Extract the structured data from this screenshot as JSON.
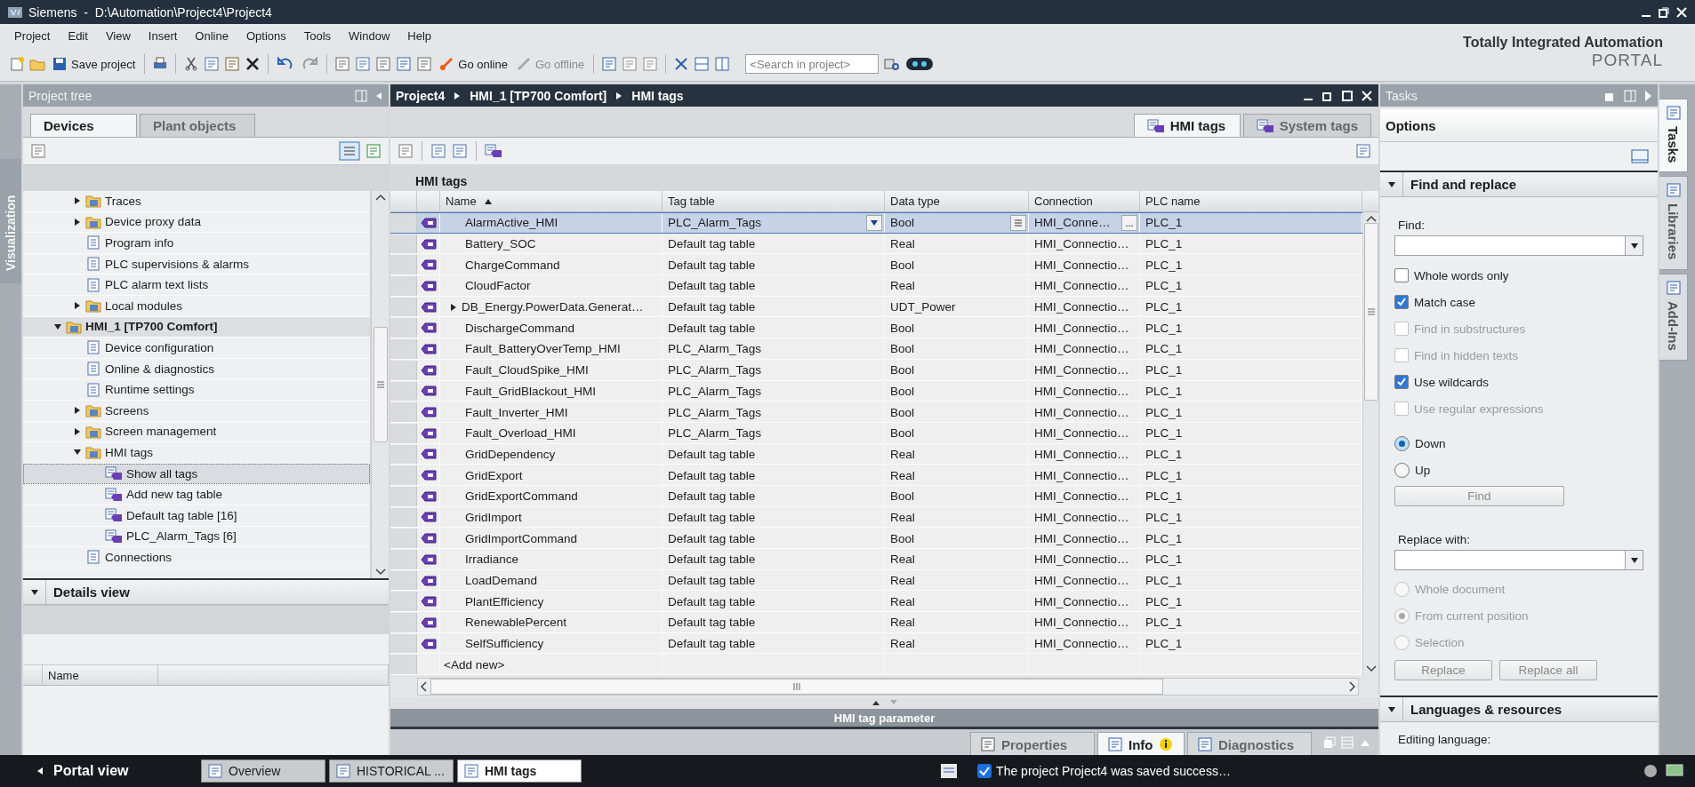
{
  "window": {
    "title": "Siemens  -  D:\\Automation\\Project4\\Project4"
  },
  "menu": [
    "Project",
    "Edit",
    "View",
    "Insert",
    "Online",
    "Options",
    "Tools",
    "Window",
    "Help"
  ],
  "toolbar": {
    "save_label": "Save project",
    "go_online": "Go online",
    "go_offline": "Go offline",
    "search_placeholder": "<Search in project>"
  },
  "brand": {
    "line1": "Totally Integrated Automation",
    "line2": "PORTAL"
  },
  "left_strip": {
    "label": "Visualization"
  },
  "project_tree": {
    "title": "Project tree",
    "tabs": [
      {
        "label": "Devices",
        "selected": true
      },
      {
        "label": "Plant objects",
        "selected": false
      }
    ],
    "continued_items": [
      {
        "label": "Traces",
        "expanded": false,
        "selected": false
      },
      {
        "label": "Device proxy data",
        "expanded": false,
        "selected": false
      },
      {
        "label": "Program info",
        "selected": false
      },
      {
        "label": "PLC supervisions & alarms",
        "selected": false
      },
      {
        "label": "PLC alarm text lists",
        "selected": false
      },
      {
        "label": "Local modules",
        "expanded": false,
        "selected": false
      }
    ],
    "items": [
      {
        "label": "HMI_1 [TP700 Comfort]",
        "expanded": true,
        "selected": false,
        "children": [
          {
            "label": "Device configuration",
            "selected": false
          },
          {
            "label": "Online & diagnostics",
            "selected": false
          },
          {
            "label": "Runtime settings",
            "selected": false
          },
          {
            "label": "Screens",
            "expanded": false,
            "selected": false
          },
          {
            "label": "Screen management",
            "expanded": false,
            "selected": false
          },
          {
            "label": "HMI tags",
            "expanded": true,
            "selected": false,
            "children": [
              {
                "label": "Show all tags",
                "selected": true
              },
              {
                "label": "Add new tag table",
                "selected": false
              },
              {
                "label": "Default tag table [16]",
                "selected": false
              },
              {
                "label": "PLC_Alarm_Tags [6]",
                "selected": false
              }
            ]
          },
          {
            "label": "Connections",
            "selected": false
          }
        ]
      }
    ]
  },
  "details_view": {
    "title": "Details view",
    "columns": [
      "Name"
    ]
  },
  "editor": {
    "breadcrumb": [
      "Project4",
      "HMI_1 [TP700 Comfort]",
      "HMI tags"
    ],
    "tabs": [
      {
        "label": "HMI tags",
        "selected": true
      },
      {
        "label": "System tags",
        "selected": false
      }
    ],
    "table_title": "HMI tags",
    "columns": [
      "Name",
      "Tag table",
      "Data type",
      "Connection",
      "PLC name"
    ],
    "ellipsis_button": "...",
    "rows": [
      {
        "name": "AlarmActive_HMI",
        "tag_table": "PLC_Alarm_Tags",
        "data_type": "Bool",
        "connection": "HMI_Conne…",
        "plc_name": "PLC_1",
        "selected": true,
        "expandable": false
      },
      {
        "name": "Battery_SOC",
        "tag_table": "Default tag table",
        "data_type": "Real",
        "connection": "HMI_Connectio…",
        "plc_name": "PLC_1",
        "selected": false,
        "expandable": false
      },
      {
        "name": "ChargeCommand",
        "tag_table": "Default tag table",
        "data_type": "Bool",
        "connection": "HMI_Connectio…",
        "plc_name": "PLC_1",
        "selected": false,
        "expandable": false
      },
      {
        "name": "CloudFactor",
        "tag_table": "Default tag table",
        "data_type": "Real",
        "connection": "HMI_Connectio…",
        "plc_name": "PLC_1",
        "selected": false,
        "expandable": false
      },
      {
        "name": "DB_Energy.PowerData.Generat…",
        "tag_table": "Default tag table",
        "data_type": "UDT_Power",
        "connection": "HMI_Connectio…",
        "plc_name": "PLC_1",
        "selected": false,
        "expandable": true
      },
      {
        "name": "DischargeCommand",
        "tag_table": "Default tag table",
        "data_type": "Bool",
        "connection": "HMI_Connectio…",
        "plc_name": "PLC_1",
        "selected": false,
        "expandable": false
      },
      {
        "name": "Fault_BatteryOverTemp_HMI",
        "tag_table": "PLC_Alarm_Tags",
        "data_type": "Bool",
        "connection": "HMI_Connectio…",
        "plc_name": "PLC_1",
        "selected": false,
        "expandable": false
      },
      {
        "name": "Fault_CloudSpike_HMI",
        "tag_table": "PLC_Alarm_Tags",
        "data_type": "Bool",
        "connection": "HMI_Connectio…",
        "plc_name": "PLC_1",
        "selected": false,
        "expandable": false
      },
      {
        "name": "Fault_GridBlackout_HMI",
        "tag_table": "PLC_Alarm_Tags",
        "data_type": "Bool",
        "connection": "HMI_Connectio…",
        "plc_name": "PLC_1",
        "selected": false,
        "expandable": false
      },
      {
        "name": "Fault_Inverter_HMI",
        "tag_table": "PLC_Alarm_Tags",
        "data_type": "Bool",
        "connection": "HMI_Connectio…",
        "plc_name": "PLC_1",
        "selected": false,
        "expandable": false
      },
      {
        "name": "Fault_Overload_HMI",
        "tag_table": "PLC_Alarm_Tags",
        "data_type": "Bool",
        "connection": "HMI_Connectio…",
        "plc_name": "PLC_1",
        "selected": false,
        "expandable": false
      },
      {
        "name": "GridDependency",
        "tag_table": "Default tag table",
        "data_type": "Real",
        "connection": "HMI_Connectio…",
        "plc_name": "PLC_1",
        "selected": false,
        "expandable": false
      },
      {
        "name": "GridExport",
        "tag_table": "Default tag table",
        "data_type": "Real",
        "connection": "HMI_Connectio…",
        "plc_name": "PLC_1",
        "selected": false,
        "expandable": false
      },
      {
        "name": "GridExportCommand",
        "tag_table": "Default tag table",
        "data_type": "Bool",
        "connection": "HMI_Connectio…",
        "plc_name": "PLC_1",
        "selected": false,
        "expandable": false
      },
      {
        "name": "GridImport",
        "tag_table": "Default tag table",
        "data_type": "Real",
        "connection": "HMI_Connectio…",
        "plc_name": "PLC_1",
        "selected": false,
        "expandable": false
      },
      {
        "name": "GridImportCommand",
        "tag_table": "Default tag table",
        "data_type": "Bool",
        "connection": "HMI_Connectio…",
        "plc_name": "PLC_1",
        "selected": false,
        "expandable": false
      },
      {
        "name": "Irradiance",
        "tag_table": "Default tag table",
        "data_type": "Real",
        "connection": "HMI_Connectio…",
        "plc_name": "PLC_1",
        "selected": false,
        "expandable": false
      },
      {
        "name": "LoadDemand",
        "tag_table": "Default tag table",
        "data_type": "Real",
        "connection": "HMI_Connectio…",
        "plc_name": "PLC_1",
        "selected": false,
        "expandable": false
      },
      {
        "name": "PlantEfficiency",
        "tag_table": "Default tag table",
        "data_type": "Real",
        "connection": "HMI_Connectio…",
        "plc_name": "PLC_1",
        "selected": false,
        "expandable": false
      },
      {
        "name": "RenewablePercent",
        "tag_table": "Default tag table",
        "data_type": "Real",
        "connection": "HMI_Connectio…",
        "plc_name": "PLC_1",
        "selected": false,
        "expandable": false
      },
      {
        "name": "SelfSufficiency",
        "tag_table": "Default tag table",
        "data_type": "Real",
        "connection": "HMI_Connectio…",
        "plc_name": "PLC_1",
        "selected": false,
        "expandable": false
      }
    ],
    "add_new": "<Add new>",
    "parameter_bar": "HMI tag parameter"
  },
  "inspector_tabs": [
    {
      "label": "Properties",
      "selected": false
    },
    {
      "label": "Info",
      "selected": true
    },
    {
      "label": "Diagnostics",
      "selected": false
    }
  ],
  "tasks": {
    "title": "Tasks",
    "options_label": "Options",
    "find_replace": {
      "title": "Find and replace",
      "find_label": "Find:",
      "checkboxes": [
        {
          "label": "Whole words only",
          "checked": false,
          "disabled": false
        },
        {
          "label": "Match case",
          "checked": true,
          "disabled": false
        },
        {
          "label": "Find in substructures",
          "checked": false,
          "disabled": true
        },
        {
          "label": "Find in hidden texts",
          "checked": false,
          "disabled": true
        },
        {
          "label": "Use wildcards",
          "checked": true,
          "disabled": false
        },
        {
          "label": "Use regular expressions",
          "checked": false,
          "disabled": true
        }
      ],
      "direction": [
        {
          "label": "Down",
          "selected": true,
          "disabled": false
        },
        {
          "label": "Up",
          "selected": false,
          "disabled": false
        }
      ],
      "find_button": "Find",
      "replace_label": "Replace with:",
      "scope": [
        {
          "label": "Whole document",
          "selected": false,
          "disabled": true
        },
        {
          "label": "From current position",
          "selected": true,
          "disabled": true
        },
        {
          "label": "Selection",
          "selected": false,
          "disabled": true
        }
      ],
      "buttons": [
        "Replace",
        "Replace all"
      ]
    },
    "languages": {
      "title": "Languages & resources",
      "editing_language_label": "Editing language:"
    }
  },
  "side_tabs": [
    {
      "label": "Tasks",
      "selected": true
    },
    {
      "label": "Libraries",
      "selected": false
    },
    {
      "label": "Add-Ins",
      "selected": false
    }
  ],
  "taskbar": {
    "portal_view": "Portal view",
    "items": [
      {
        "label": "Overview",
        "selected": false
      },
      {
        "label": "HISTORICAL ...",
        "selected": false
      },
      {
        "label": "HMI tags",
        "selected": true
      }
    ],
    "status": "The project Project4 was saved success…"
  }
}
